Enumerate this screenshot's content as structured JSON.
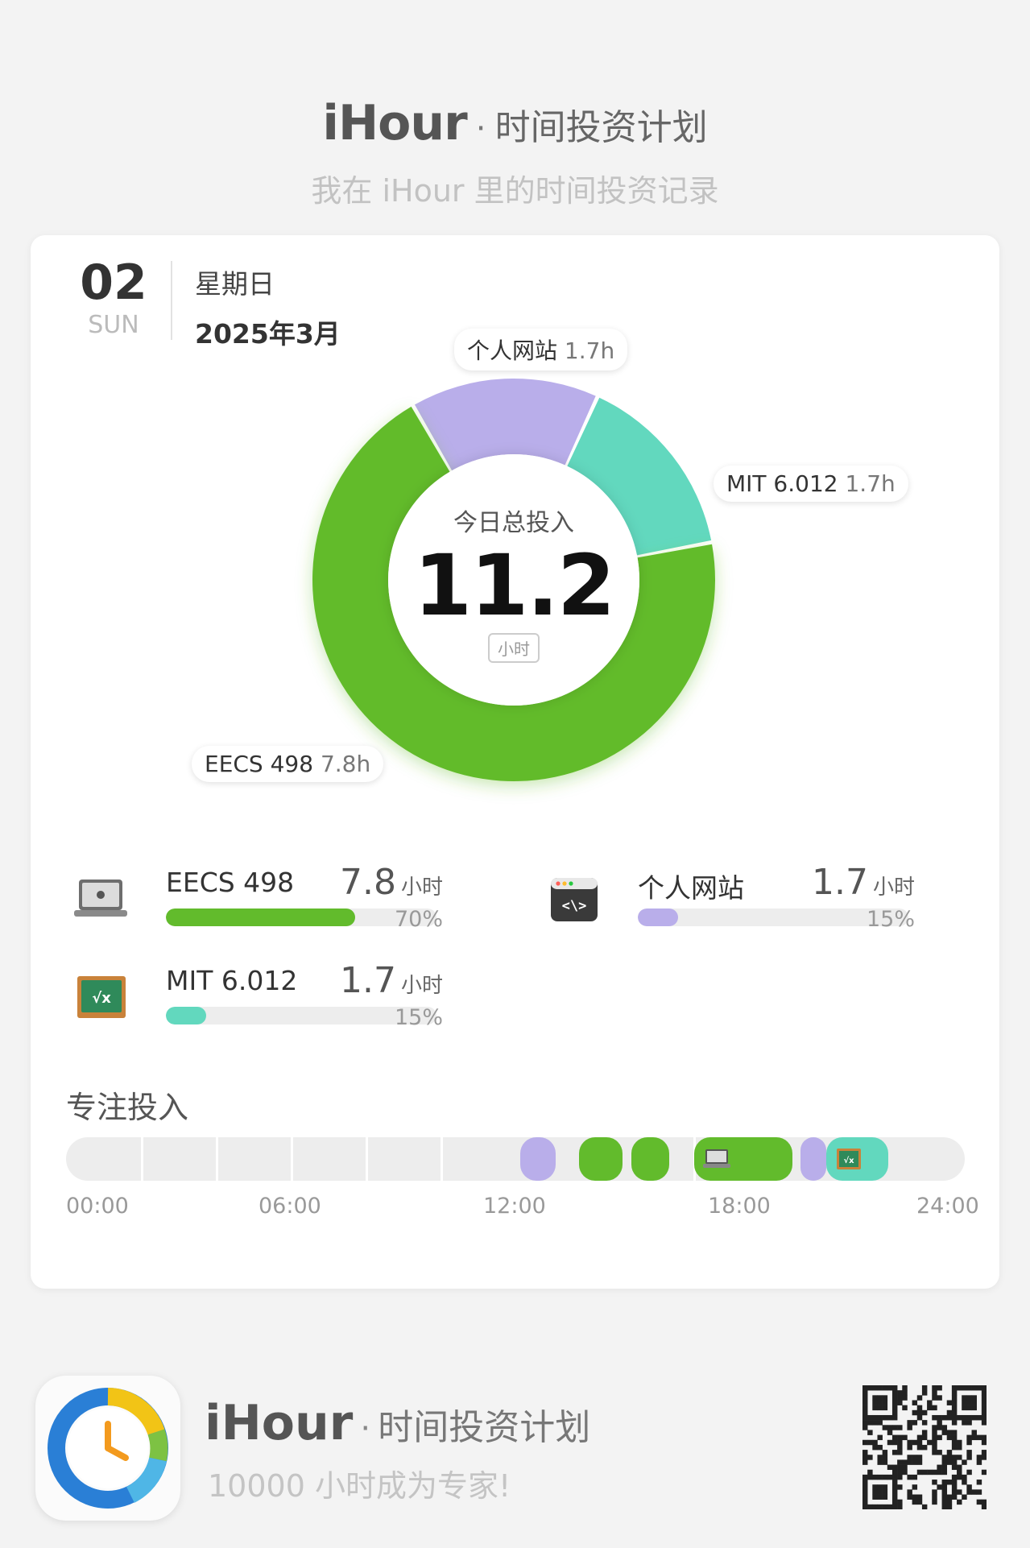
{
  "header": {
    "brand": "iHour",
    "dot": "·",
    "tagline": "时间投资计划",
    "subtitle": "我在 iHour 里的时间投资记录"
  },
  "date": {
    "day": "02",
    "weekday_short": "SUN",
    "weekday": "星期日",
    "year_month": "2025年3月"
  },
  "donut": {
    "label": "今日总投入",
    "total": "11.2",
    "unit": "小时"
  },
  "chart_data": {
    "type": "pie",
    "title": "今日总投入",
    "series": [
      {
        "name": "EECS 498",
        "value": 7.8,
        "color": "#62bb2c"
      },
      {
        "name": "个人网站",
        "value": 1.7,
        "color": "#b9aeea"
      },
      {
        "name": "MIT 6.012",
        "value": 1.7,
        "color": "#62d8be"
      }
    ],
    "callouts": [
      {
        "name": "个人网站",
        "value": "1.7h"
      },
      {
        "name": "MIT 6.012",
        "value": "1.7h"
      },
      {
        "name": "EECS 498",
        "value": "7.8h"
      }
    ]
  },
  "stats": [
    {
      "name": "EECS 498",
      "hours": "7.8",
      "unit": "小时",
      "percent": "70%",
      "fraction": 0.7,
      "color": "#62bb2c",
      "icon": "laptop-icon"
    },
    {
      "name": "个人网站",
      "hours": "1.7",
      "unit": "小时",
      "percent": "15%",
      "fraction": 0.15,
      "color": "#b9aeea",
      "icon": "code-window-icon"
    },
    {
      "name": "MIT 6.012",
      "hours": "1.7",
      "unit": "小时",
      "percent": "15%",
      "fraction": 0.15,
      "color": "#62d8be",
      "icon": "blackboard-icon"
    }
  ],
  "focus": {
    "title": "专注投入",
    "segments": [
      {
        "start": 12.12,
        "end": 13.08,
        "color": "#b9aeea",
        "icon": ""
      },
      {
        "start": 13.7,
        "end": 14.85,
        "color": "#62bb2c",
        "icon": ""
      },
      {
        "start": 15.1,
        "end": 16.1,
        "color": "#62bb2c",
        "icon": ""
      },
      {
        "start": 16.78,
        "end": 19.4,
        "color": "#62bb2c",
        "icon": "laptop-icon"
      },
      {
        "start": 19.62,
        "end": 20.3,
        "color": "#b9aeea",
        "icon": ""
      },
      {
        "start": 20.3,
        "end": 21.96,
        "color": "#62d8be",
        "icon": "blackboard-icon"
      }
    ],
    "ticks": [
      "00:00",
      "06:00",
      "12:00",
      "18:00",
      "24:00"
    ]
  },
  "footer": {
    "brand": "iHour",
    "dot": "·",
    "tagline": "时间投资计划",
    "slogan": "10000 小时成为专家!"
  }
}
